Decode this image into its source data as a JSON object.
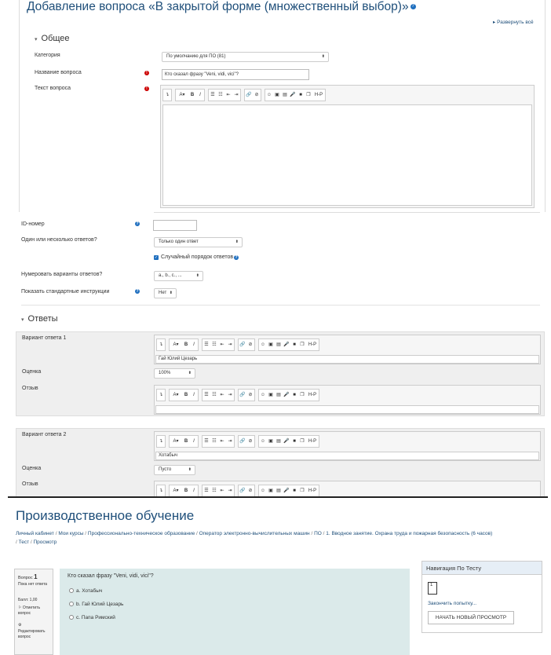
{
  "form": {
    "title": "Добавление вопроса «В закрытой форме (множественный выбор)»",
    "expand_all": "Развернуть всё",
    "section_general": "Общее",
    "category_label": "Категория",
    "category_value": "По умолчанию для ПО (81)",
    "question_name_label": "Название вопроса",
    "question_name_value": "Кто сказал фразу \"Veni, vidi, vici\"?",
    "question_text_label": "Текст вопроса",
    "id_label": "ID-номер",
    "single_multi_label": "Один или несколько ответов?",
    "single_multi_value": "Только один ответ",
    "shuffle_label": "Случайный порядок ответов",
    "numbering_label": "Нумеровать варианты ответов?",
    "numbering_value": "a., b., c., ...",
    "instructions_label": "Показать стандартные инструкции",
    "instructions_value": "Нет",
    "section_answers": "Ответы",
    "answer1_label": "Вариант ответа 1",
    "answer1_value": "Гай Юлий Цезарь",
    "grade_label": "Оценка",
    "grade1_value": "100%",
    "feedback_label": "Отзыв",
    "answer2_label": "Вариант ответа 2",
    "answer2_value": "Хотабыч",
    "grade2_value": "Пусто"
  },
  "toolbar": {
    "icons": [
      "expand-icon",
      "font-icon",
      "bold-icon",
      "italic-icon",
      "bullet-list-icon",
      "numbered-list-icon",
      "outdent-icon",
      "indent-icon",
      "link-icon",
      "unlink-icon",
      "emoji-icon",
      "image-icon",
      "media-icon",
      "record-audio-icon",
      "record-video-icon",
      "manage-files-icon",
      "h5p-icon"
    ],
    "bold": "B",
    "italic": "I",
    "font": "A",
    "h5p": "H-P"
  },
  "preview": {
    "title": "Производственное обучение",
    "breadcrumb": [
      "Личный кабинет",
      "Мои курсы",
      "Профессионально-техническое образование",
      "Оператор электронно-вычислительных машин",
      "ПО",
      "1. Вводное занятие. Охрана труда и пожарная безопасность (6 часов)",
      "Тест",
      "Просмотр"
    ],
    "question_label": "Вопрос",
    "question_number": "1",
    "status": "Пока нет ответа",
    "score": "Балл: 1,00",
    "flag": "Отметить вопрос",
    "edit": "Редактировать вопрос",
    "question_text": "Кто сказал фразу \"Veni, vidi, vici\"?",
    "options": [
      "a. Хотабыч",
      "b. Гай Юлий Цезарь",
      "c. Папа Римский"
    ],
    "nav_title": "Навигация По Тесту",
    "nav_number": "1",
    "finish_link": "Закончить попытку...",
    "new_preview": "НАЧАТЬ НОВЫЙ ПРОСМОТР"
  }
}
